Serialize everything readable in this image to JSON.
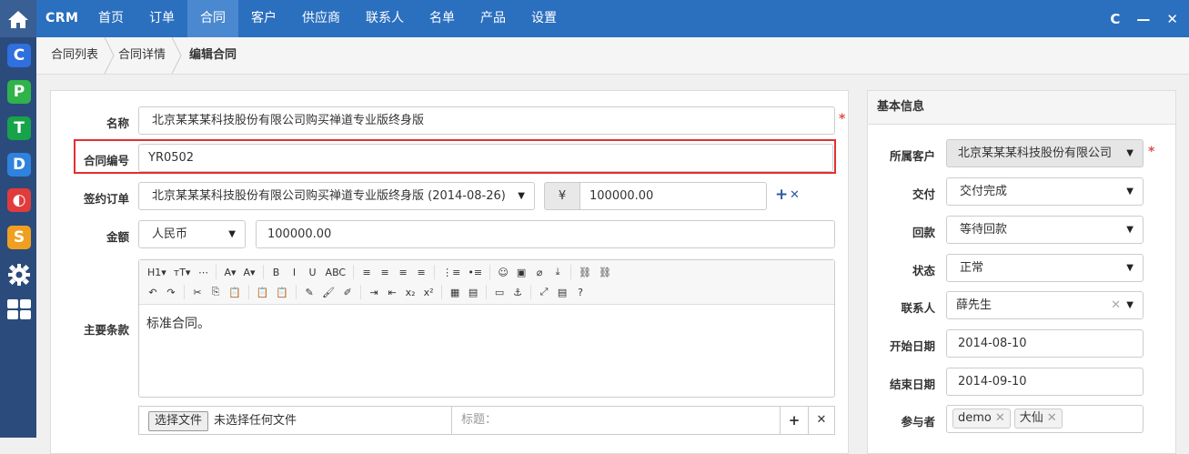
{
  "app": {
    "brand": "CRM"
  },
  "nav": {
    "items": [
      "首页",
      "订单",
      "合同",
      "客户",
      "供应商",
      "联系人",
      "名单",
      "产品",
      "设置"
    ],
    "active_index": 2
  },
  "window": {
    "refresh": "C",
    "minimize": "—",
    "close": "✕"
  },
  "breadcrumb": {
    "items": [
      "合同列表",
      "合同详情",
      "编辑合同"
    ]
  },
  "sidebar": {
    "apps": [
      {
        "letter": "C",
        "color": "#2f6fde"
      },
      {
        "letter": "P",
        "color": "#2fb34a"
      },
      {
        "letter": "T",
        "color": "#16a34a"
      },
      {
        "letter": "D",
        "color": "#2f82de"
      },
      {
        "letter": "◐",
        "color": "#e23b3b"
      },
      {
        "letter": "S",
        "color": "#f0a020"
      }
    ]
  },
  "form": {
    "name": {
      "label": "名称",
      "value": "北京某某某科技股份有限公司购买禅道专业版终身版"
    },
    "code": {
      "label": "合同编号",
      "value": "YR0502"
    },
    "order": {
      "label": "签约订单",
      "value": "北京某某某科技股份有限公司购买禅道专业版终身版 (2014-08-26)",
      "currency_symbol": "¥",
      "amount": "100000.00",
      "add": "+",
      "remove": "✕"
    },
    "amount": {
      "label": "金额",
      "currency": "人民币",
      "value": "100000.00"
    },
    "terms": {
      "label": "主要条款",
      "content": "标准合同。"
    },
    "attachment": {
      "button": "选择文件",
      "status": "未选择任何文件",
      "title_placeholder": "标题：",
      "add": "+",
      "remove": "✕"
    }
  },
  "toolbar": {
    "row1": [
      "H1▾",
      "тT▾",
      "⋯",
      "A▾",
      "A▾",
      "B",
      "I",
      "U",
      "ABC",
      "≡",
      "≡",
      "≡",
      "≡",
      "⋮≡",
      "•≡",
      "☺",
      "▣",
      "⌀",
      "⤓",
      "⛓",
      "⛓"
    ],
    "row2": [
      "↶",
      "↷",
      "✂",
      "⎘",
      "📋",
      "📋",
      "📋",
      "✎",
      "🖌",
      "✐",
      "⇥",
      "⇤",
      "x₂",
      "x²",
      "▦",
      "▤",
      "▭",
      "⚓",
      "⤢",
      "▤",
      "?"
    ]
  },
  "info": {
    "title": "基本信息",
    "customer": {
      "label": "所属客户",
      "value": "北京某某某科技股份有限公司"
    },
    "delivery": {
      "label": "交付",
      "value": "交付完成"
    },
    "payment": {
      "label": "回款",
      "value": "等待回款"
    },
    "status": {
      "label": "状态",
      "value": "正常"
    },
    "contact": {
      "label": "联系人",
      "value": "薛先生"
    },
    "start": {
      "label": "开始日期",
      "value": "2014-08-10"
    },
    "end": {
      "label": "结束日期",
      "value": "2014-09-10"
    },
    "participants": {
      "label": "参与者",
      "tags": [
        "demo",
        "大仙"
      ]
    }
  }
}
